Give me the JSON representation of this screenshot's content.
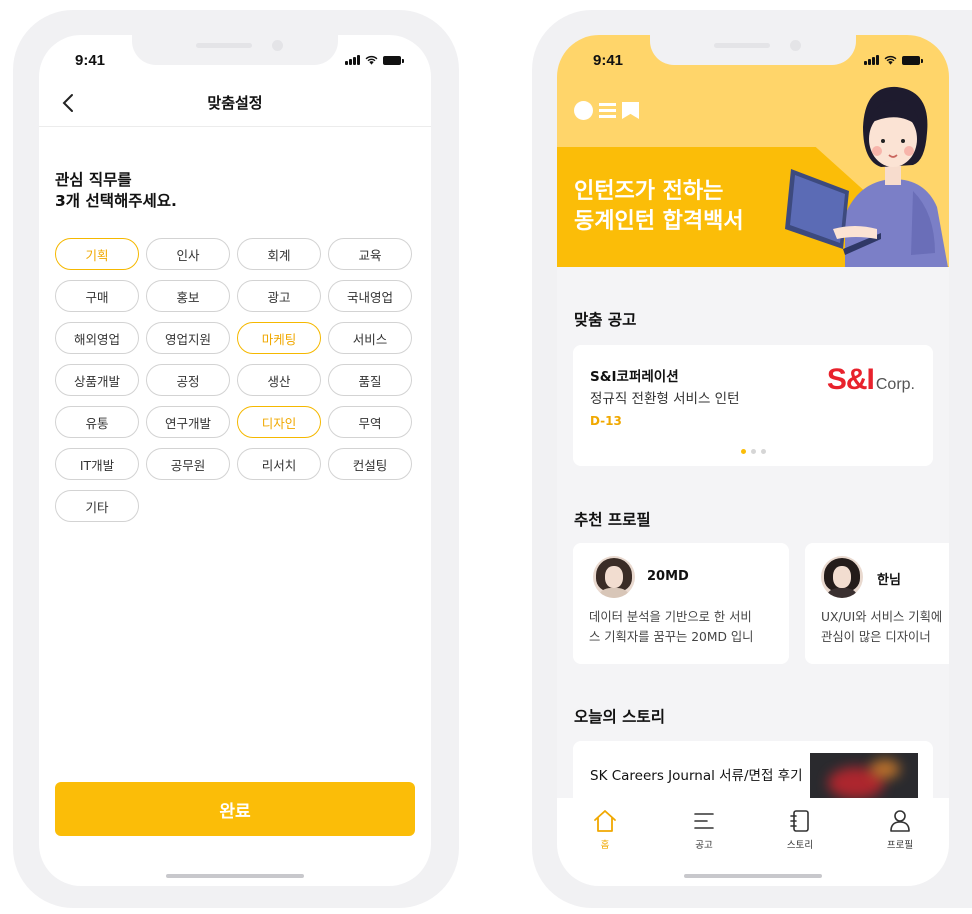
{
  "left_phone": {
    "status_time": "9:41",
    "nav_title": "맞춤설정",
    "question_lines": [
      "관심 직무를",
      "3개 선택해주세요."
    ],
    "chips": [
      {
        "label": "기획",
        "selected": true
      },
      {
        "label": "인사",
        "selected": false
      },
      {
        "label": "회계",
        "selected": false
      },
      {
        "label": "교육",
        "selected": false
      },
      {
        "label": "구매",
        "selected": false
      },
      {
        "label": "홍보",
        "selected": false
      },
      {
        "label": "광고",
        "selected": false
      },
      {
        "label": "국내영업",
        "selected": false
      },
      {
        "label": "해외영업",
        "selected": false
      },
      {
        "label": "영업지원",
        "selected": false
      },
      {
        "label": "마케팅",
        "selected": true
      },
      {
        "label": "서비스",
        "selected": false
      },
      {
        "label": "상품개발",
        "selected": false
      },
      {
        "label": "공정",
        "selected": false
      },
      {
        "label": "생산",
        "selected": false
      },
      {
        "label": "품질",
        "selected": false
      },
      {
        "label": "유통",
        "selected": false
      },
      {
        "label": "연구개발",
        "selected": false
      },
      {
        "label": "디자인",
        "selected": true
      },
      {
        "label": "무역",
        "selected": false
      },
      {
        "label": "IT개발",
        "selected": false
      },
      {
        "label": "공무원",
        "selected": false
      },
      {
        "label": "리서치",
        "selected": false
      },
      {
        "label": "컨설팅",
        "selected": false
      },
      {
        "label": "기타",
        "selected": false
      }
    ],
    "done_label": "완료"
  },
  "right_phone": {
    "status_time": "9:41",
    "banner_lines": [
      "인턴즈가 전하는",
      "동계인턴 합격백서"
    ],
    "sections": {
      "jobs": "맞춤 공고",
      "profiles": "추천 프로필",
      "stories": "오늘의 스토리"
    },
    "job": {
      "company": "S&I코퍼레이션",
      "title": "정규직 전환형 서비스 인턴",
      "dday": "D-13",
      "logo_main": "S&I",
      "logo_sub": "Corp."
    },
    "profiles": [
      {
        "name": "20MD",
        "desc_lines": [
          "데이터 분석을 기반으로 한 서비",
          "스 기획자를 꿈꾸는 20MD 입니"
        ]
      },
      {
        "name": "한님",
        "desc_lines": [
          "UX/UI와 서비스 기획에",
          "관심이 많은 디자이너"
        ]
      }
    ],
    "story": {
      "title": "SK Careers Journal 서류/면접 후기"
    },
    "tabs": [
      {
        "label": "홈",
        "icon": "home-icon",
        "active": true
      },
      {
        "label": "공고",
        "icon": "list-icon",
        "active": false
      },
      {
        "label": "스토리",
        "icon": "notebook-icon",
        "active": false
      },
      {
        "label": "프로필",
        "icon": "person-icon",
        "active": false
      }
    ],
    "colors": {
      "accent": "#fbbd08",
      "banner_light": "#ffd56a",
      "logo_red": "#e8222c"
    }
  }
}
